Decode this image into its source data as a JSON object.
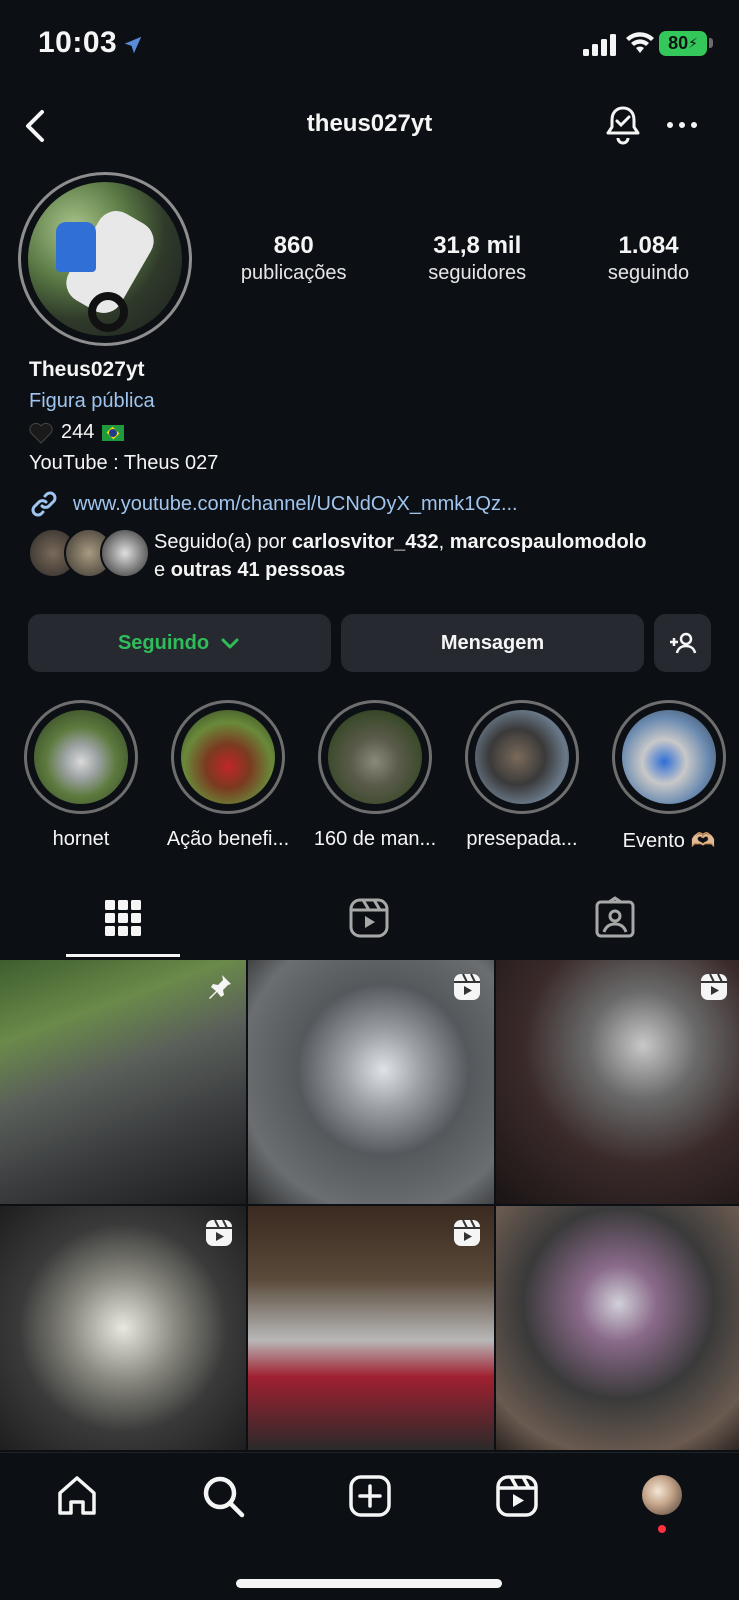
{
  "status_bar": {
    "time": "10:03",
    "battery": "80"
  },
  "header": {
    "username": "theus027yt"
  },
  "stats": [
    {
      "value": "860",
      "label": "publicações"
    },
    {
      "value": "31,8 mil",
      "label": "seguidores"
    },
    {
      "value": "1.084",
      "label": "seguindo"
    }
  ],
  "bio": {
    "name": "Theus027yt",
    "category": "Figura pública",
    "line1_number": "244",
    "line2": "YouTube : Theus 027",
    "link": "www.youtube.com/channel/UCNdOyX_mmk1Qz..."
  },
  "followed_by": {
    "prefix": "Seguido(a) por ",
    "user1": "carlosvitor_432",
    "separator": ", ",
    "user2": "marcospaulomodolo",
    "and": "e ",
    "others": "outras 41 pessoas"
  },
  "buttons": {
    "following": "Seguindo",
    "message": "Mensagem"
  },
  "highlights": [
    {
      "label": "hornet"
    },
    {
      "label": "Ação benefi..."
    },
    {
      "label": "160 de man..."
    },
    {
      "label": "presepada..."
    },
    {
      "label": "Evento 🫶🏼"
    }
  ],
  "icons": {
    "back": "chevron-left-icon",
    "bell": "bell-check-icon",
    "more": "more-horizontal-icon",
    "grid_tab": "grid-icon",
    "reels_tab": "reels-icon",
    "tagged_tab": "tagged-icon"
  },
  "colors": {
    "accent_following": "#2ebd59",
    "link": "#a0c5ee",
    "background": "#0c1014"
  }
}
